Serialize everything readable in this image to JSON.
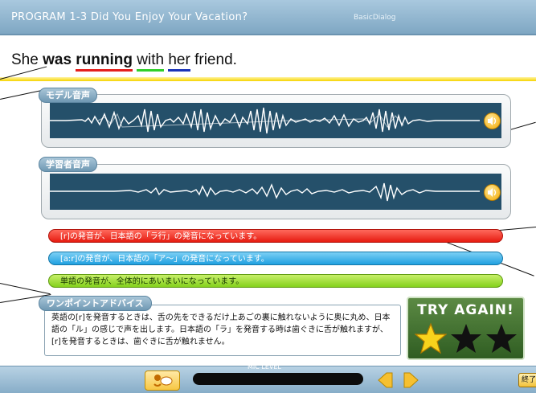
{
  "header": {
    "title": "PROGRAM 1-3 Did You Enjoy Your Vacation?",
    "mode": "BasicDialog"
  },
  "sentence": {
    "w1": "She",
    "w2": "was",
    "w3": "running",
    "w4": "with",
    "w5": "her",
    "w6": "friend."
  },
  "model_audio": {
    "label": "モデル音声",
    "icon": "speaker-icon"
  },
  "learner_audio": {
    "label": "学習者音声",
    "icon": "speaker-icon"
  },
  "diagnosis": {
    "item1": "[r]の発音が、日本語の「ラ行」の発音になっています。",
    "item2": "[aːr]の発音が、日本語の「ア～」の発音になっています。",
    "item3": "単語の発音が、全体的にあいまいになっています。"
  },
  "advice": {
    "label": "ワンポイントアドバイス",
    "text": "英語の[r]を発音するときは、舌の先をできるだけ上あごの裏に触れないように奥に丸め、日本語の「ル」の感じで声を出します。日本語の「ラ」を発音する時は歯ぐきに舌が触れますが、[r]を発音するときは、歯ぐきに舌が触れません。"
  },
  "result": {
    "label": "TRY AGAIN!",
    "stars_earned": 1,
    "stars_total": 3
  },
  "bottom": {
    "mic_level_label": "MIC LEVEL",
    "end_label": "終了"
  },
  "colors": {
    "underline_red": "#e4201d",
    "underline_green": "#2fcf2a",
    "underline_blue": "#1a33b8",
    "bar_red": "#e61b10",
    "bar_blue": "#20a0e0",
    "bar_green": "#84d11c"
  }
}
